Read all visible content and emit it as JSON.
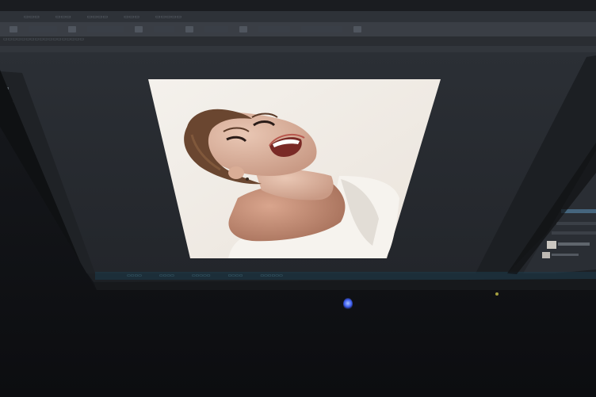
{
  "photo": {
    "description_icon": "portrait-photo",
    "colors": {
      "workspace": "#2a2d33",
      "canvas_paper": "#f1ece6",
      "monitor_bezel": "#16181c",
      "desk": "#0f1114",
      "accent_led": "#3d5cf0",
      "toolbar": "#3b3f46"
    }
  }
}
